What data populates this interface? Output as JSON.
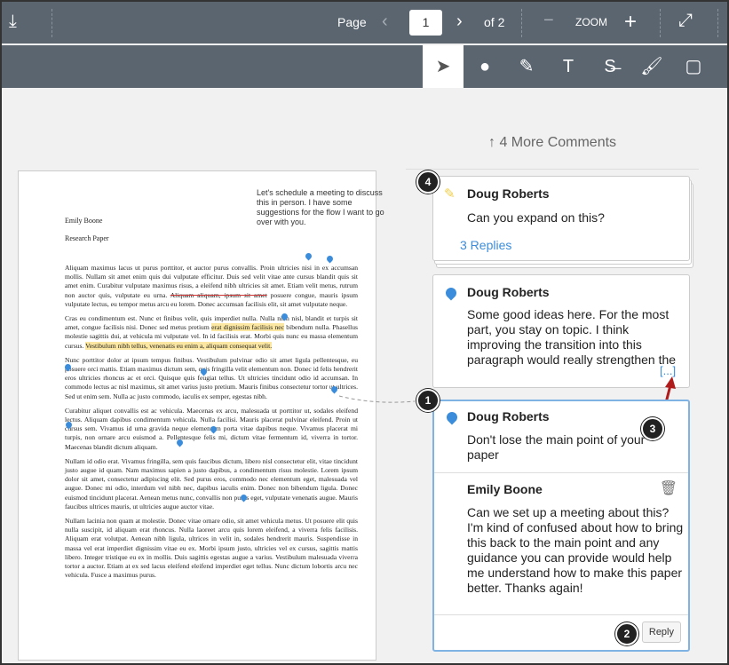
{
  "toolbar": {
    "page_label": "Page",
    "page_value": "1",
    "of_label": "of 2",
    "zoom_label": "ZOOM",
    "download_icon": "download-icon",
    "fullscreen_icon": "expand-icon"
  },
  "tools": [
    {
      "name": "select-tool",
      "glyph": "➤"
    },
    {
      "name": "pin-tool",
      "glyph": "●"
    },
    {
      "name": "highlight-tool",
      "glyph": "✎"
    },
    {
      "name": "text-tool",
      "glyph": "T"
    },
    {
      "name": "strikeout-tool",
      "glyph": "S̶"
    },
    {
      "name": "draw-tool",
      "glyph": "🖌"
    },
    {
      "name": "area-tool",
      "glyph": "▢"
    }
  ],
  "more_comments": "↑  4 More Comments",
  "document": {
    "note": "Let's schedule a meeting to discuss this in person. I have some suggestions for the flow I want to go over with you.",
    "author": "Emily Boone",
    "title": "Research Paper",
    "paragraphs": [
      [
        {
          "t": "Aliquam maximus lacus ut purus porttitor, et auctor purus convallis. Proin ultricies nisi in ex accumsan mollis. Nullam sit amet enim quis dui vulputate efficitur. Duis sed velit vitae ante cursus blandit quis sit amet enim. Curabitur vulputate maximus risus, a eleifend nibh ultricies sit amet. Etiam velit metus, rutrum non auctor quis, vulputate eu urna. ",
          "s": ""
        },
        {
          "t": "Aliquam aliquam, ipsum sit amet",
          "s": "st"
        },
        {
          "t": " posuere congue, mauris ipsum vulputate lectus, eu tempor metus arcu eu lorem. Donec accumsan facilisis elit, sit amet vulputate neque.",
          "s": ""
        }
      ],
      [
        {
          "t": "Cras eu condimentum est. Nunc et finibus velit, quis imperdiet nulla. Nulla nibh nisl, blandit et turpis sit amet, congue facilisis nisi. Donec sed metus pretium ",
          "s": ""
        },
        {
          "t": "erat dignissim facilisis nec",
          "s": "hl"
        },
        {
          "t": " bibendum nulla. Phasellus molestie sagittis dui, at vehicula mi vulputate vel. In id facilisis erat. Morbi quis nunc eu massa elementum cursus. ",
          "s": ""
        },
        {
          "t": "Vestibulum nibh tellus, venenatis eu enim a, aliquam consequat velit.",
          "s": "hl"
        }
      ],
      [
        {
          "t": "Nunc porttitor dolor at ipsum tempus finibus. Vestibulum pulvinar odio sit amet ligula pellentesque, eu posuere orci mattis. Etiam maximus dictum sem, quis fringilla velit elementum non. Donec id felis hendrerit eros ultricies rhoncus ac et orci. Quisque quis feugiat tellus. Ut ultricies tincidunt odio id accumsan. In commodo lectus ac nisl maximus, sit amet varius justo pretium. Mauris finibus consectetur tortor ut ultrices. Sed ut enim sem. Nulla ac justo commodo, iaculis ex semper, egestas nibh.",
          "s": ""
        }
      ],
      [
        {
          "t": "Curabitur aliquet convallis est ac vehicula. Maecenas ex arcu, malesuada ut porttitor ut, sodales eleifend lectus. Aliquam dapibus condimentum vehicula. Nulla facilisi. Mauris placerat pulvinar eleifend. Proin ut cursus sem. Vivamus id urna gravida neque elementum porta vitae dapibus neque. Vivamus placerat mi turpis, non ornare arcu euismod a. Pellentesque felis mi, dictum vitae fermentum id, viverra in tortor. Maecenas blandit dictum aliquam.",
          "s": ""
        }
      ],
      [
        {
          "t": "Nullam id odio erat. Vivamus fringilla, sem quis faucibus dictum, libero nisl consectetur elit, vitae tincidunt justo augue id quam. Nam maximus sapien a justo dapibus, a condimentum risus molestie. Lorem ipsum dolor sit amet, consectetur adipiscing elit. Sed purus eros, commodo nec elementum eget, malesuada vel augue. Donec mi odio, interdum vel nibh nec, dapibus iaculis enim. Donec non bibendum ligula. Donec euismod tincidunt placerat. Aenean metus nunc, convallis non purus eget, vulputate venenatis augue. Mauris faucibus ultrices mauris, ut ultricies augue auctor vitae.",
          "s": ""
        }
      ],
      [
        {
          "t": "Nullam lacinia non quam at molestie. Donec vitae ornare odio, sit amet vehicula metus. Ut posuere elit quis nulla suscipit, id aliquam erat rhoncus. Nulla laoreet arcu quis lorem eleifend, a viverra felis facilisis. Aliquam erat volutpat. Aenean nibh ligula, ultrices in velit in, sodales hendrerit mauris. Suspendisse in massa vel erat imperdiet dignissim vitae eu ex. Morbi ipsum justo, ultricies vel ex cursus, sagittis mattis libero. Integer tristique eu ex in mollis. Duis sagittis egestas augue a varius. Vestibulum malesuada viverra tortor a auctor. Etiam at ex sed lacus eleifend eleifend imperdiet eget tellus. Nunc dictum lobortis arcu nec vehicula. Fusce a maximus purus.",
          "s": ""
        }
      ]
    ]
  },
  "comments": [
    {
      "author": "Doug Roberts",
      "text": "Can you expand on this?",
      "replies": "3 Replies",
      "badge": "4"
    },
    {
      "author": "Doug Roberts",
      "text": "Some good ideas here. For the most part, you stay on topic. I think improving the transition into this paragraph would really strengthen the point you're trying to make. T",
      "more": "[...]",
      "badge": "3"
    },
    {
      "author": "Doug Roberts",
      "text": "Don't lose the main point of your paper",
      "badge": "1",
      "reply": {
        "author": "Emily Boone",
        "text": "Can we set up a meeting about this? I'm kind of confused about how to bring this back to the main point and any guidance you can provide would help me understand how to make this paper better. Thanks again!"
      },
      "reply_button": "Reply",
      "reply_badge": "2"
    }
  ],
  "colors": {
    "toolbar": "#5b6570",
    "accent": "#3b8ddb",
    "highlight": "#fbe7a1",
    "callout": "#b01c1c"
  }
}
